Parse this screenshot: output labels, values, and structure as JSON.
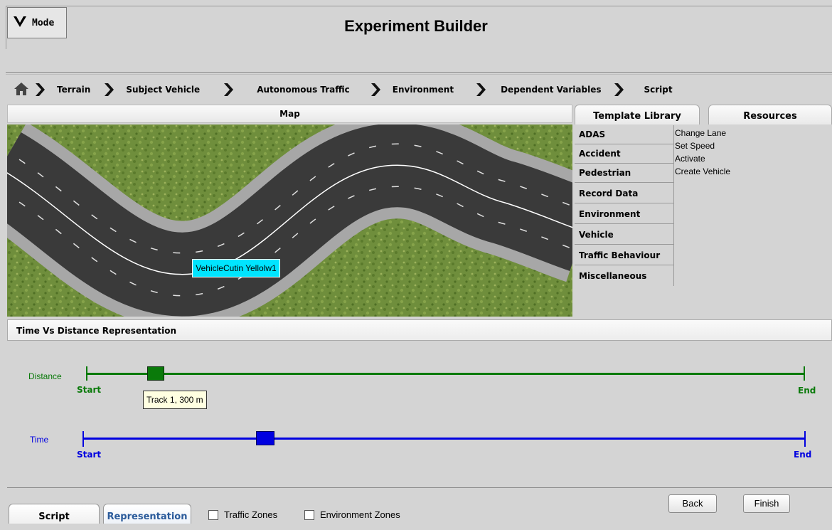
{
  "app": {
    "title": "Experiment Builder",
    "mode_label": "Mode"
  },
  "breadcrumb": {
    "items": [
      "Terrain",
      "Subject Vehicle",
      "Autonomous Traffic",
      "Environment",
      "Dependent Variables",
      "Script"
    ]
  },
  "map": {
    "header": "Map",
    "vehicle_label": "VehicleCutin Yellolw1"
  },
  "library": {
    "tabs": [
      "Template Library",
      "Resources"
    ],
    "categories": [
      "ADAS",
      "Accident",
      "Pedestrian",
      "Record Data",
      "Environment",
      "Vehicle",
      "Traffic Behaviour",
      "Miscellaneous"
    ],
    "templates": [
      "Change Lane",
      "Set Speed",
      "Activate",
      "Create Vehicle"
    ]
  },
  "representation": {
    "header": "Time Vs Distance Representation",
    "distance": {
      "label": "Distance",
      "start": "Start",
      "end": "End",
      "color": "#0a7a0a",
      "marker_fraction": 0.085
    },
    "time": {
      "label": "Time",
      "start": "Start",
      "end": "End",
      "color": "#0000e0",
      "marker_fraction": 0.24
    },
    "tooltip": "Track 1, 300 m"
  },
  "bottom": {
    "tabs": [
      "Script",
      "Representation"
    ],
    "checkboxes": [
      "Traffic Zones",
      "Environment Zones"
    ],
    "back": "Back",
    "finish": "Finish"
  }
}
